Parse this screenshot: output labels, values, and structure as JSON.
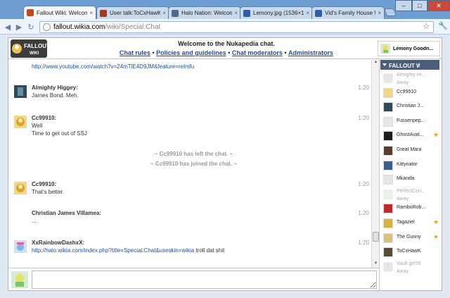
{
  "browser": {
    "tabs": [
      {
        "title": "Fallout Wiki: Welcome",
        "active": true,
        "color": "#c24a1c"
      },
      {
        "title": "User talk:ToCxHawK - T",
        "active": false,
        "color": "#a33a1c"
      },
      {
        "title": "Halo Nation: Welcome",
        "active": false,
        "color": "#4d6a8d"
      },
      {
        "title": "Lemony.jpg (1536×153",
        "active": false,
        "color": "#2f5fa6"
      },
      {
        "title": "Vid's Family House Wi",
        "active": false,
        "color": "#2f5fa6"
      }
    ],
    "url_host": "fallout.wikia.com",
    "url_path": "/wiki/Special:Chat"
  },
  "header": {
    "logo_line1": "FALLOUT",
    "logo_line2": "WIKI",
    "welcome": "Welcome to the Nukapedia chat.",
    "links": [
      "Chat rules",
      "Policies and guidelines",
      "Chat moderators",
      "Administrators"
    ],
    "separator": "•",
    "self_user": "Lemony Goodn..."
  },
  "messages": [
    {
      "name": "",
      "time": "",
      "lines": [],
      "link": "http://www.youtube.com/watch?v=24mTlE4D9JM&feature=relmfu",
      "tail": ""
    },
    {
      "name": "Almighty Higgey:",
      "time": "1:20",
      "lines": [
        "James Bond. Meh."
      ],
      "link": "",
      "tail": ""
    },
    {
      "name": "Cc99910:",
      "time": "1:20",
      "lines": [
        "Well",
        "Time to get out of SSJ"
      ],
      "link": "",
      "tail": ""
    },
    {
      "name": "Cc99910:",
      "time": "1:20",
      "lines": [
        "That's better."
      ],
      "link": "",
      "tail": ""
    },
    {
      "name": "Christian James Villamea:",
      "time": "1:20",
      "lines": [
        "..."
      ],
      "link": "",
      "tail": ""
    },
    {
      "name": "XxRainbowDashxX:",
      "time": "1:20",
      "lines": [],
      "link": "http://halo.wikia.com/index.php?title=Special:Chat&useskin=wikia",
      "tail": " troll dat shit"
    }
  ],
  "inline_alerts": [
    "~ Cc99910 has left the chat. ~",
    "~ Cc99910 has joined the chat. ~"
  ],
  "sidebar": {
    "wiki_label": "FALLOUT WIKI",
    "users": [
      {
        "name": "Almighty Hi...",
        "status": "Away",
        "away": true,
        "badge": false
      },
      {
        "name": "Cc99910",
        "status": "",
        "away": false,
        "badge": false
      },
      {
        "name": "Christian J...",
        "status": "",
        "away": false,
        "badge": false
      },
      {
        "name": "Fussenpep...",
        "status": "",
        "away": false,
        "badge": false
      },
      {
        "name": "GhostAvat...",
        "status": "",
        "away": false,
        "badge": true
      },
      {
        "name": "Great Mara",
        "status": "",
        "away": false,
        "badge": false
      },
      {
        "name": "Kittynator",
        "status": "",
        "away": false,
        "badge": false
      },
      {
        "name": "Mkarafa",
        "status": "",
        "away": false,
        "badge": false
      },
      {
        "name": "PerfectCon...",
        "status": "Away",
        "away": true,
        "badge": false
      },
      {
        "name": "RamboRob...",
        "status": "",
        "away": false,
        "badge": false
      },
      {
        "name": "Tagaziel",
        "status": "",
        "away": false,
        "badge": true
      },
      {
        "name": "The Gunny",
        "status": "",
        "away": false,
        "badge": true
      },
      {
        "name": "ToCxHawK",
        "status": "",
        "away": false,
        "badge": false
      },
      {
        "name": "Vault girl76",
        "status": "Away",
        "away": true,
        "badge": false
      }
    ]
  },
  "input": {
    "value": ""
  }
}
